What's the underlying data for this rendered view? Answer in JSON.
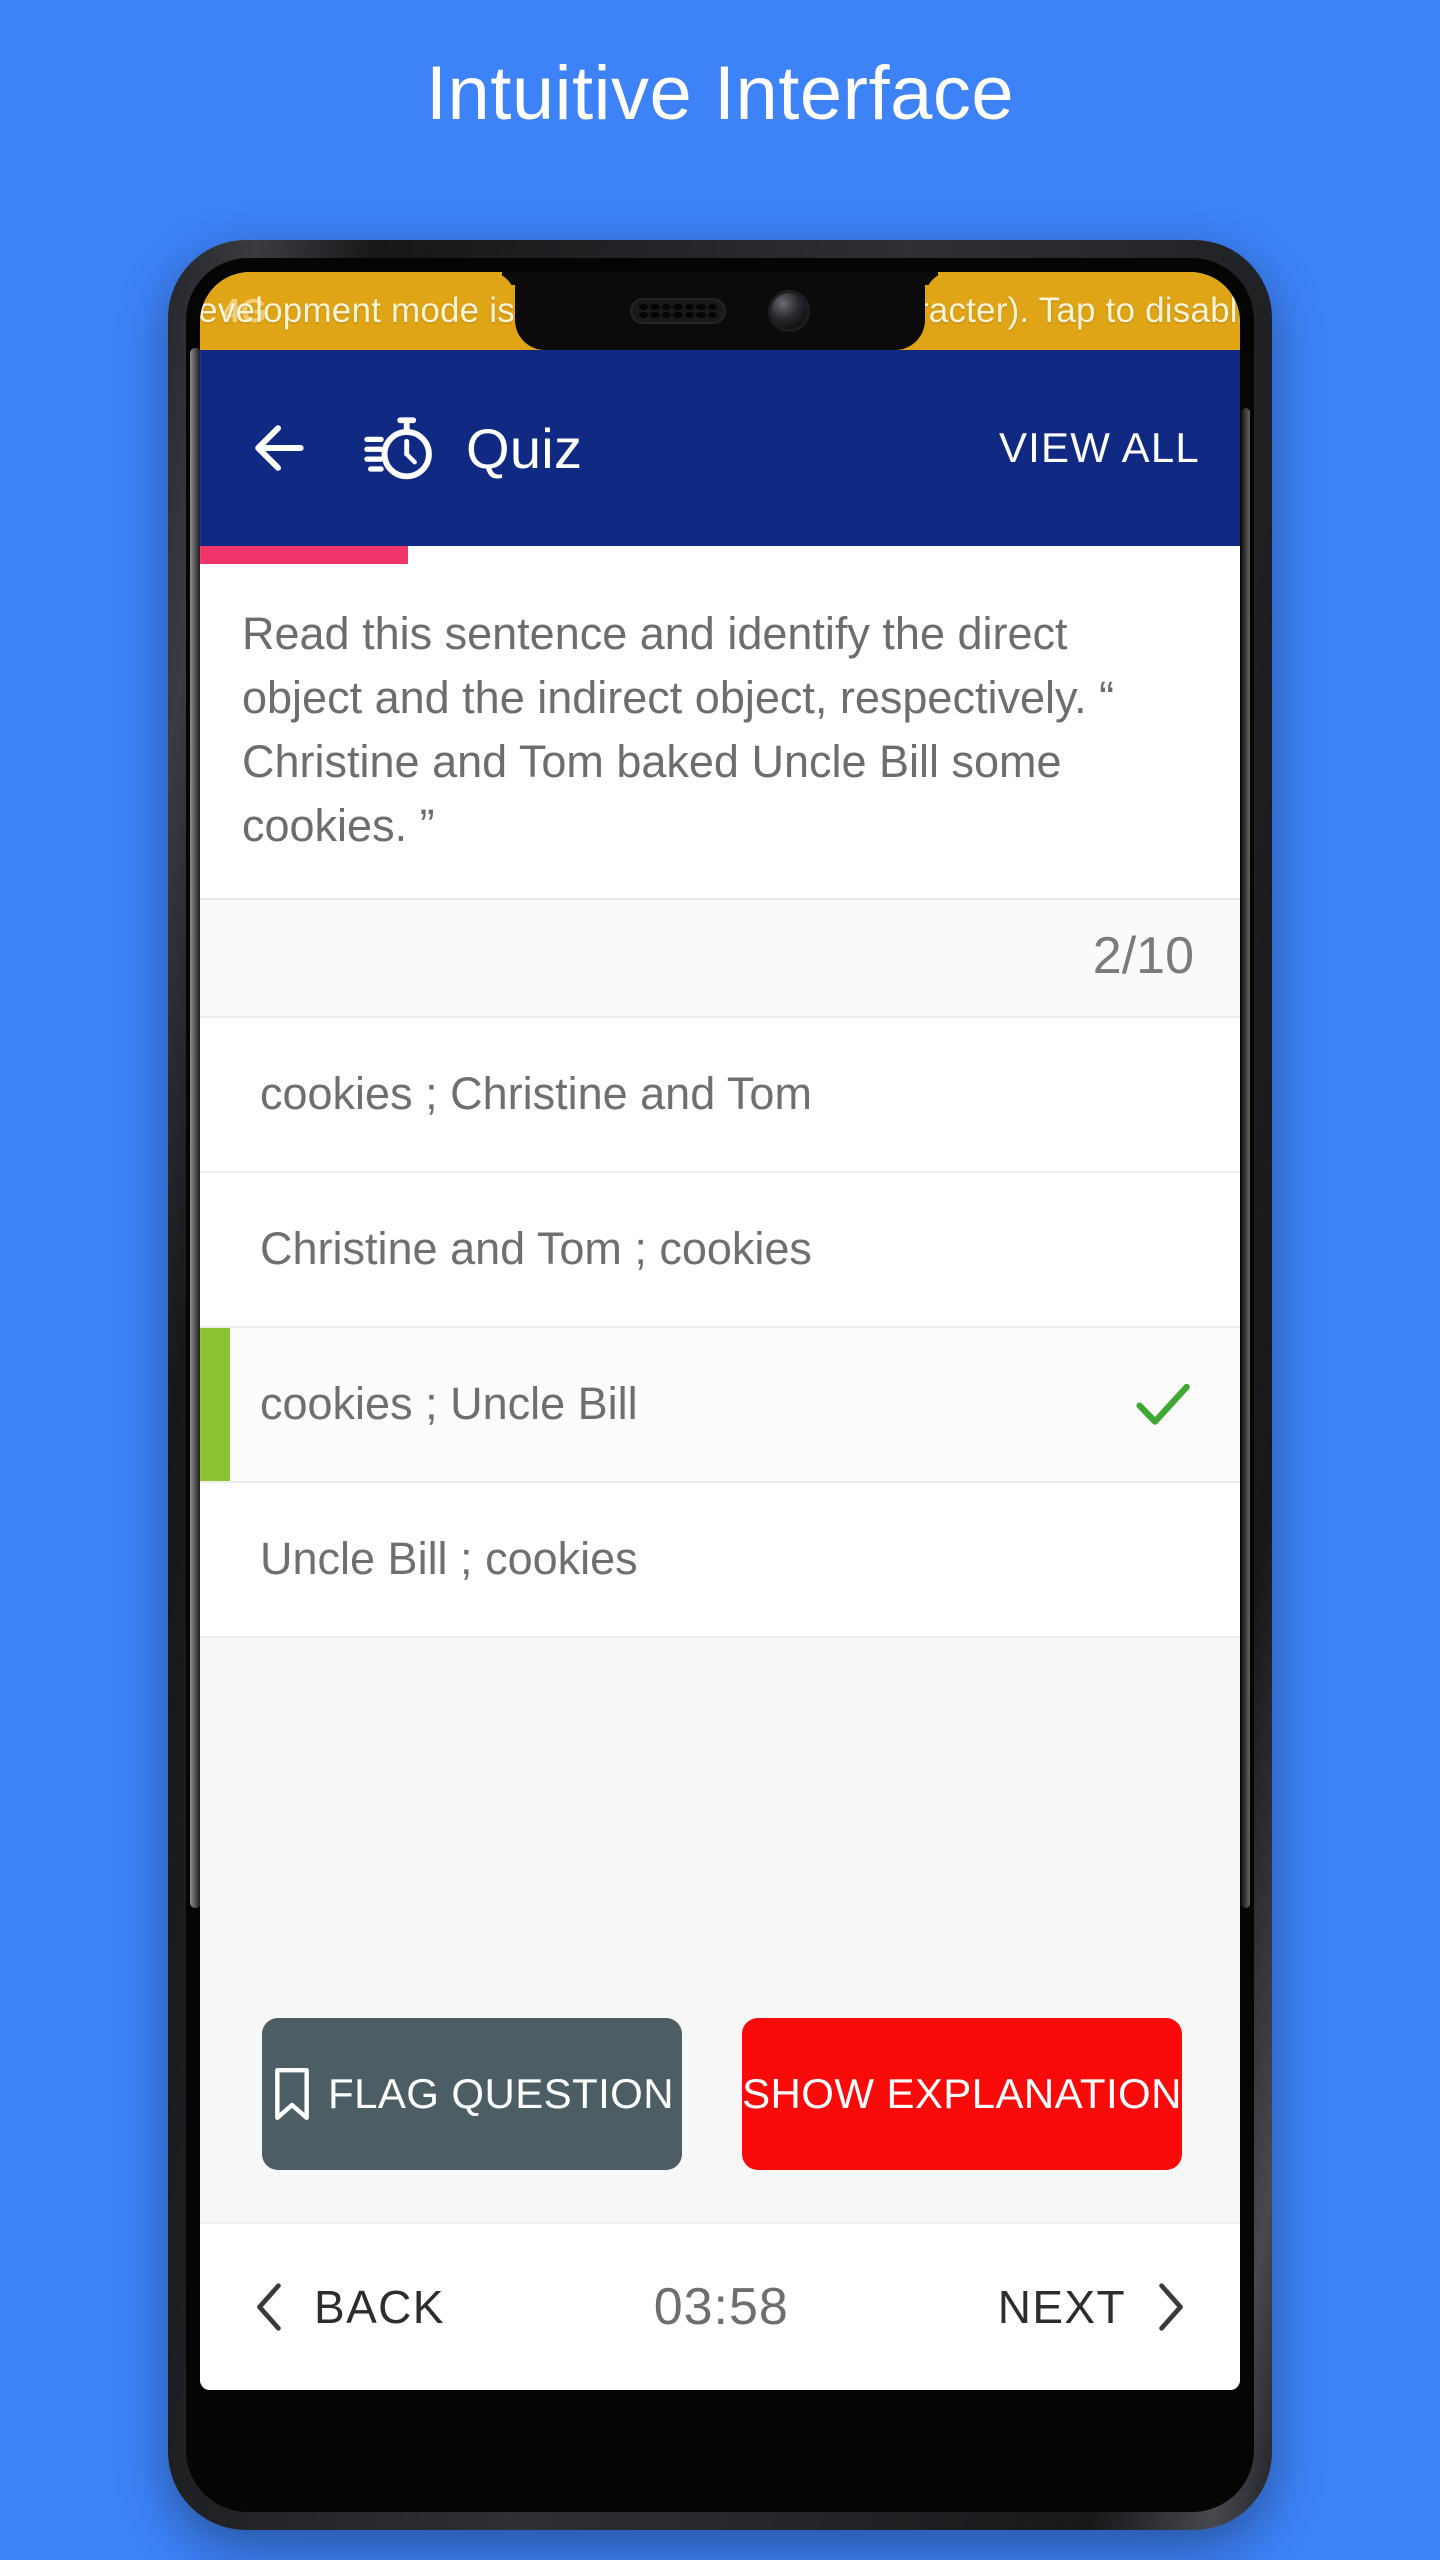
{
  "headline": "Intuitive Interface",
  "status_bar": {
    "network": "4G",
    "dev_banner": "Development mode is on (running in debug character). Tap to disable.",
    "banner_color": "#e0a516"
  },
  "app_bar": {
    "back_icon": "arrow-left-icon",
    "timer_icon": "stopwatch-icon",
    "title": "Quiz",
    "action_label": "VIEW ALL",
    "background_color": "#102a83"
  },
  "progress": {
    "percent": 20,
    "color": "#f0356b"
  },
  "question": {
    "text": "Read this sentence and identify the direct object and the indirect object, respectively. “ Christine and Tom baked Uncle Bill some cookies. ”",
    "counter": "2/10"
  },
  "options": [
    {
      "label": "cookies ; Christine and Tom",
      "selected": false,
      "checked": false
    },
    {
      "label": "Christine and Tom ; cookies",
      "selected": false,
      "checked": false
    },
    {
      "label": "cookies ; Uncle Bill",
      "selected": true,
      "checked": true
    },
    {
      "label": "Uncle Bill ; cookies",
      "selected": false,
      "checked": false
    }
  ],
  "selection_colors": {
    "accent_bar": "#8cc335",
    "check": "#3ea832"
  },
  "actions": {
    "flag_label": "FLAG QUESTION",
    "flag_icon": "bookmark-icon",
    "flag_color": "#4d5d64",
    "explain_label": "SHOW EXPLANATION",
    "explain_color": "#fb0a0a"
  },
  "bottom_nav": {
    "back_label": "BACK",
    "back_icon": "chevron-left-icon",
    "timer": "03:58",
    "next_label": "NEXT",
    "next_icon": "chevron-right-icon"
  }
}
